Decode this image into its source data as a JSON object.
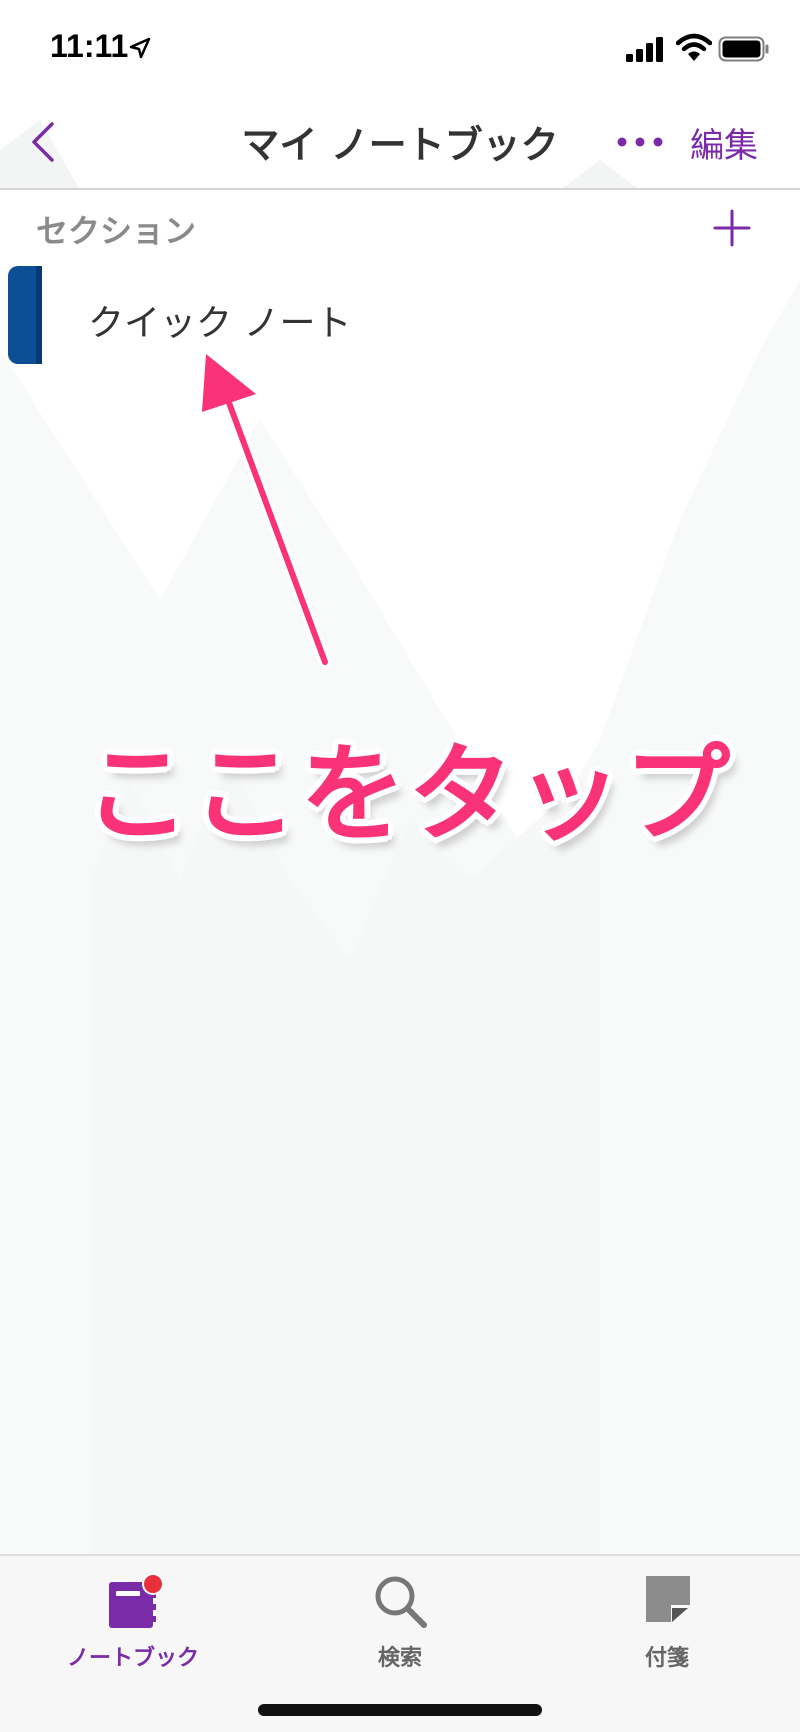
{
  "status_bar": {
    "time": "11:11"
  },
  "nav": {
    "title": "マイ ノートブック",
    "edit_label": "編集"
  },
  "sections": {
    "header": "セクション",
    "items": [
      {
        "label": "クイック ノート",
        "color": "#0c4f95"
      }
    ]
  },
  "annotation": {
    "text": "ここをタップ",
    "color": "#fa3378"
  },
  "tab_bar": {
    "tabs": [
      {
        "label": "ノートブック",
        "icon": "notebook-icon",
        "active": true
      },
      {
        "label": "検索",
        "icon": "search-icon",
        "active": false
      },
      {
        "label": "付箋",
        "icon": "sticky-note-icon",
        "active": false
      }
    ]
  },
  "colors": {
    "accent": "#7a2ba8",
    "badge": "#e8303a",
    "section_tab": "#0c4f95"
  }
}
